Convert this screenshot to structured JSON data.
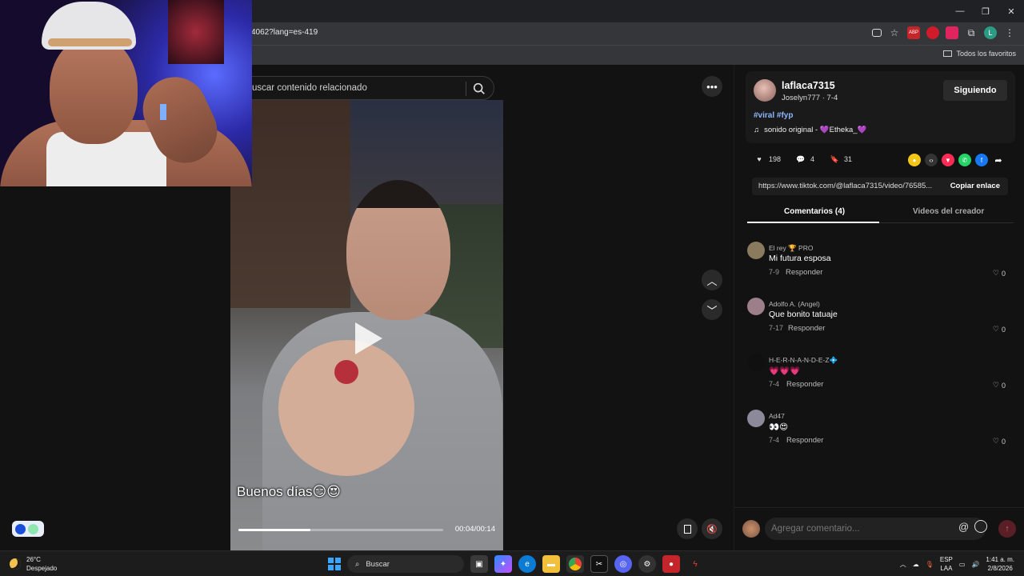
{
  "browser": {
    "url": "4062?lang=es-419",
    "bookmarks_label": "Todos los favoritos"
  },
  "search": {
    "placeholder": "uscar contenido relacionado"
  },
  "video": {
    "caption": "Buenos días😏😍",
    "time": "00:04/00:14",
    "progress": 0.35
  },
  "post": {
    "username": "laflaca7315",
    "subline": "Joselyn777 · 7-4",
    "follow_label": "Siguiendo",
    "tags": "#viral #fyp",
    "music": "sonido original - 💜Etheka_💜",
    "likes": "198",
    "comments": "4",
    "saves": "31",
    "link": "https://www.tiktok.com/@laflaca7315/video/76585...",
    "copy_label": "Copiar enlace"
  },
  "tabs": {
    "comments": "Comentarios (4)",
    "creator": "Videos del creador"
  },
  "comments": [
    {
      "name": "El rey 🏆 PRO",
      "text": "Mi futura esposa",
      "date": "7-9",
      "reply": "Responder",
      "likes": "0",
      "avatar_color": "#8a7a5e"
    },
    {
      "name": "Adolfo A. (Angel)",
      "text": "Que bonito tatuaje",
      "date": "7-17",
      "reply": "Responder",
      "likes": "0",
      "avatar_color": "#9c7f8a"
    },
    {
      "name": "H-E-R-N-A-N-D-E-Z💠",
      "text": "💗💗💗",
      "date": "7-4",
      "reply": "Responder",
      "likes": "0",
      "avatar_color": "#101010"
    },
    {
      "name": "Ad47",
      "text": "👀😍",
      "date": "7-4",
      "reply": "Responder",
      "likes": "0",
      "avatar_color": "#8c8a9a"
    }
  ],
  "comment_input": {
    "placeholder": "Agregar comentario..."
  },
  "taskbar": {
    "temp": "26°C",
    "weather": "Despejado",
    "search": "Buscar",
    "lang_1": "ESP",
    "lang_2": "LAA",
    "time": "1:41 a. m.",
    "date": "2/8/2026"
  },
  "icons": {
    "accent": "#fe2c55",
    "link_color": "#8fb6ff"
  }
}
